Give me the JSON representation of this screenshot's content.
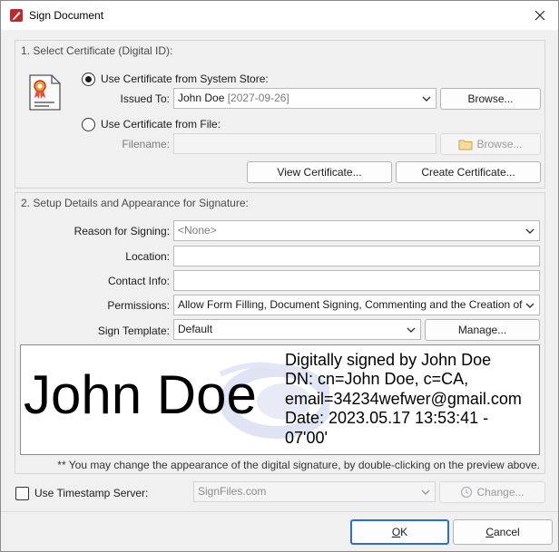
{
  "window": {
    "title": "Sign Document"
  },
  "certificate": {
    "group_title": "1. Select Certificate (Digital ID):",
    "system_store_label": "Use Certificate from System Store:",
    "issued_to_label": "Issued To:",
    "issued_to_name": "John Doe",
    "issued_to_date": "[2027-09-26]",
    "browse_label": "Browse...",
    "from_file_label": "Use Certificate from File:",
    "filename_label": "Filename:",
    "filename_value": "",
    "browse_file_label": "Browse...",
    "view_label": "View Certificate...",
    "create_label": "Create Certificate...",
    "selected_option": "system_store"
  },
  "signature": {
    "group_title": "2. Setup Details and Appearance for Signature:",
    "reason_label": "Reason for Signing:",
    "reason_value": "<None>",
    "location_label": "Location:",
    "location_value": "",
    "contact_label": "Contact Info:",
    "contact_value": "",
    "permissions_label": "Permissions:",
    "permissions_value": "Allow Form Filling, Document Signing, Commenting and the Creation of",
    "template_label": "Sign Template:",
    "template_value": "Default",
    "manage_label": "Manage..."
  },
  "preview": {
    "name": "John Doe",
    "lines": [
      "Digitally signed by John Doe",
      "DN: cn=John Doe, c=CA,",
      "email=34234wefwer@gmail.com",
      "Date: 2023.05.17 13:53:41 -",
      "07'00'"
    ],
    "hint": "** You may change the appearance of the digital signature, by double-clicking on the preview above."
  },
  "timestamp": {
    "label": "Use Timestamp Server:",
    "server_value": "SignFiles.com",
    "change_label": "Change...",
    "checked": false
  },
  "footer": {
    "ok_accel": "O",
    "ok_rest": "K",
    "cancel_accel": "C",
    "cancel_rest": "ancel"
  },
  "colors": {
    "accent": "#2a6fc9",
    "app_icon_red": "#c4262e"
  }
}
